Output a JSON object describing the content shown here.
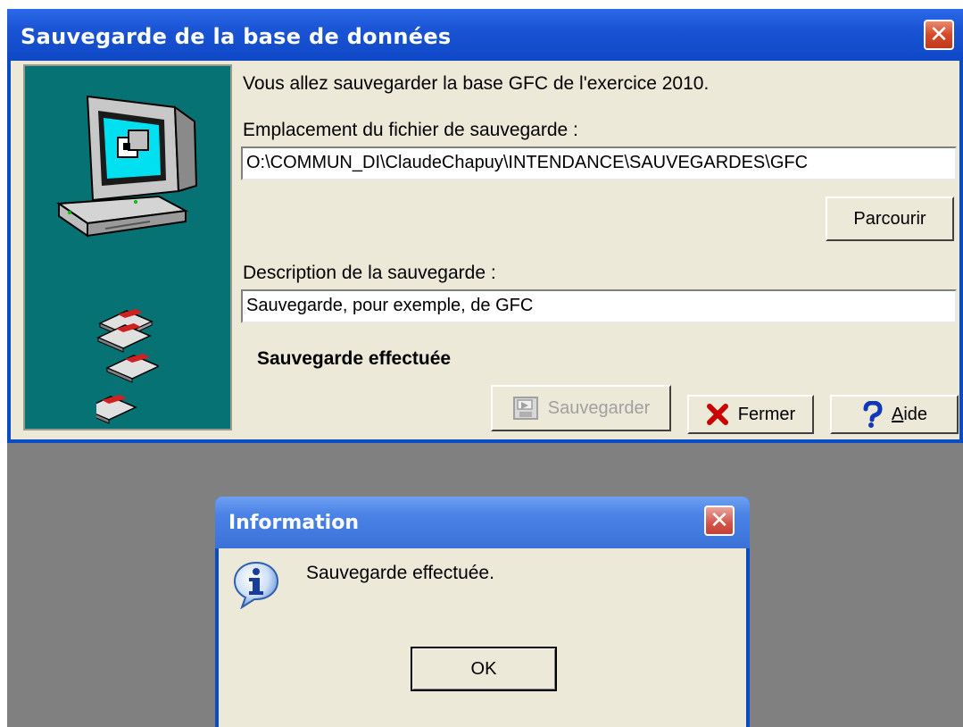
{
  "main_window": {
    "title": "Sauvegarde de la base de données",
    "intro": "Vous allez sauvegarder la base GFC de l'exercice 2010.",
    "location_label": "Emplacement du fichier de sauvegarde :",
    "location_value": "O:\\COMMUN_DI\\ClaudeChapuy\\INTENDANCE\\SAUVEGARDES\\GFC",
    "browse_label": "Parcourir",
    "description_label": "Description de la sauvegarde :",
    "description_value": "Sauvegarde, pour exemple, de GFC",
    "status_text": "Sauvegarde effectuée",
    "buttons": {
      "save": "Sauvegarder",
      "close": "Fermer",
      "help_letter": "A",
      "help_rest": "ide"
    }
  },
  "info_dialog": {
    "title": "Information",
    "message": "Sauvegarde effectuée.",
    "ok_label": "OK"
  },
  "colors": {
    "titlebar": "#0f48c6",
    "panel": "#077274",
    "face": "#ece9d8",
    "desktop": "#808080"
  },
  "icons": [
    "computer-icon",
    "floppy-disk-icon",
    "close-x-icon",
    "help-icon",
    "info-icon",
    "save-icon"
  ]
}
